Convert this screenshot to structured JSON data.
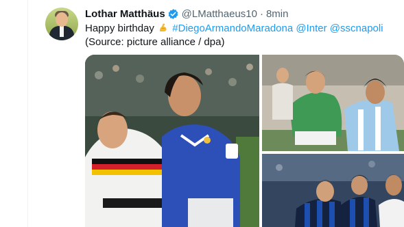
{
  "tweet": {
    "author_name": "Lothar Matthäus",
    "handle": "@LMatthaeus10",
    "separator": "·",
    "time": "8min",
    "text_prefix": "Happy birthday",
    "hashtags": [
      "#DiegoArmandoMaradona",
      "@Inter",
      "@sscnapoli"
    ],
    "source_line": "(Source: picture alliance / dpa)",
    "emoji": "flexed-biceps-icon"
  },
  "colors": {
    "link": "#1d9bf0",
    "verified": "#1d9bf0",
    "secondary_text": "#536471"
  }
}
